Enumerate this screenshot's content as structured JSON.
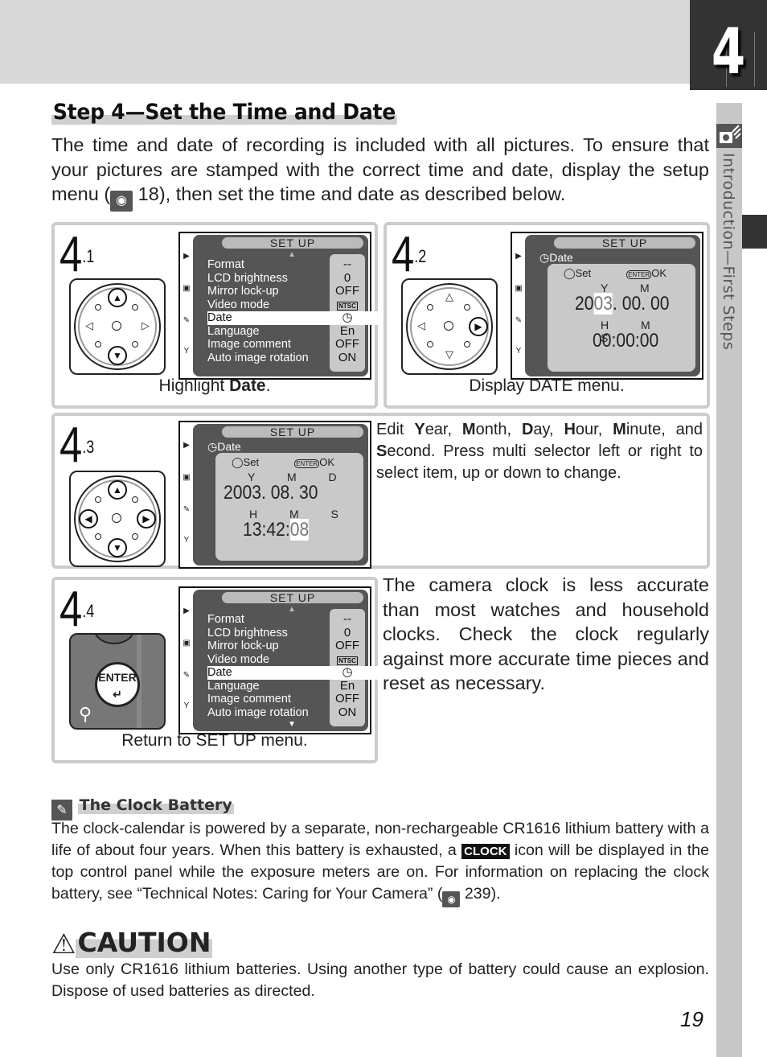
{
  "chapter": {
    "number": "4",
    "section_label": "Introduction—First Steps"
  },
  "title": "Step 4—Set the Time and Date",
  "intro": {
    "text_before_ref": "The time and date of recording is included with all pictures.  To ensure that your pictures are stamped with the correct time and date, display the setup menu (",
    "ref_page": "18",
    "text_after_ref": "), then set the time and date as described below."
  },
  "steps": [
    {
      "num": "4",
      "sub": ".1",
      "caption_pre": "Highlight ",
      "caption_bold": "Date",
      "caption_post": ".",
      "dial_active": [
        "up",
        "down"
      ]
    },
    {
      "num": "4",
      "sub": ".2",
      "caption": "Display DATE menu.",
      "dial_active": [
        "right"
      ]
    },
    {
      "num": "4",
      "sub": ".3",
      "dial_active": [
        "up",
        "down",
        "left",
        "right"
      ],
      "description": [
        {
          "t": "Edit "
        },
        {
          "b": "Y"
        },
        {
          "t": "ear, "
        },
        {
          "b": "M"
        },
        {
          "t": "onth, "
        },
        {
          "b": "D"
        },
        {
          "t": "ay, "
        },
        {
          "b": "H"
        },
        {
          "t": "our, "
        },
        {
          "b": "M"
        },
        {
          "t": "inute, and "
        },
        {
          "b": "S"
        },
        {
          "t": "econd.  Press multi selector left or right to select item, up or down to change."
        }
      ]
    },
    {
      "num": "4",
      "sub": ".4",
      "caption": "Return to SET UP menu.",
      "button_label": "ENTER",
      "side_text": "The camera clock is less accurate than most watches and household clocks.  Check the clock regularly against more accurate time pieces and reset as necessary."
    }
  ],
  "setup_menu": {
    "header": "SET  UP",
    "items": [
      {
        "label": "Format",
        "value": "--"
      },
      {
        "label": "LCD brightness",
        "value": "0"
      },
      {
        "label": "Mirror lock-up",
        "value": "OFF"
      },
      {
        "label": "Video mode",
        "value": "NTSC"
      },
      {
        "label": "Date",
        "value": "clock-icon",
        "selected": true
      },
      {
        "label": "Language",
        "value": "En"
      },
      {
        "label": "Image comment",
        "value": "OFF"
      },
      {
        "label": "Auto image rotation",
        "value": "ON"
      }
    ]
  },
  "date_menu": {
    "header": "SET  UP",
    "subtitle": "Date",
    "set_label": "Set",
    "enter_label": "ENTER",
    "ok_label": "OK",
    "date_labels": "Y M D",
    "time_labels": "H M S",
    "screen_2": {
      "year_pre": "20",
      "year_hl": "03",
      "month": "00",
      "day": "00",
      "hour": "00",
      "minute": "00",
      "second": "00",
      "highlight": "year"
    },
    "screen_3": {
      "year": "2003",
      "month": "08",
      "day": "30",
      "hour": "13",
      "minute": "42",
      "second": "08",
      "highlight": "second"
    }
  },
  "note": {
    "title": "The Clock Battery",
    "text_1": "The clock-calendar is powered by a separate, non-rechargeable CR1616 lithium battery with a life of about four years.  When this battery is exhausted, a ",
    "icon_label": "CLOCK",
    "text_2": " icon will be displayed in the top control panel while the exposure meters are on.  For information on replacing the clock battery, see “Technical Notes: Caring for Your Camera” (",
    "ref_page": "239",
    "text_3": ")."
  },
  "caution": {
    "title": "CAUTION",
    "text": "Use only CR1616 lithium batteries.  Using another type of battery could cause an explosion.  Dispose of used batteries as directed."
  },
  "page_number": "19"
}
